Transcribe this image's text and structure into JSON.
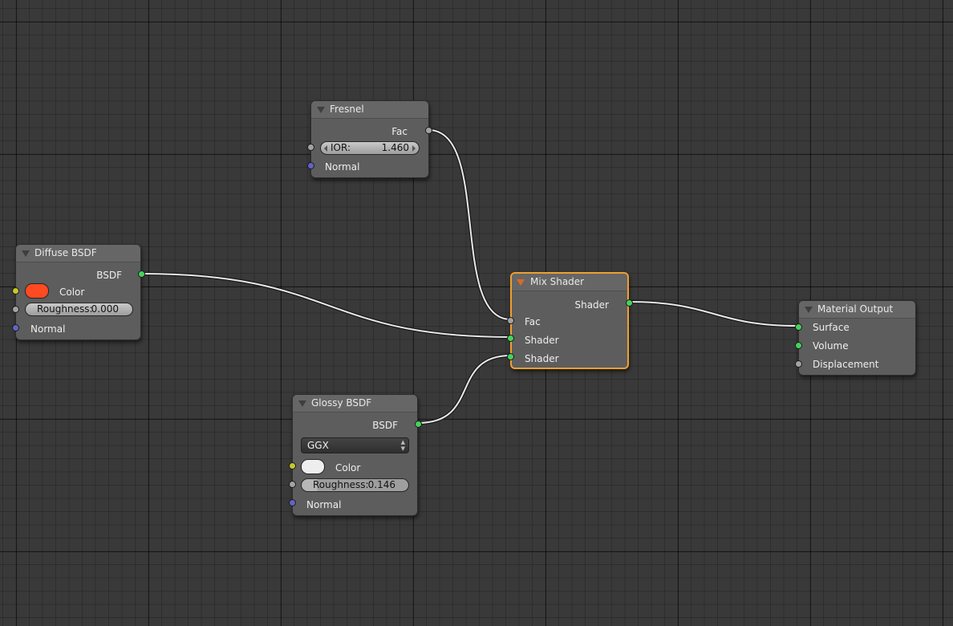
{
  "nodes": {
    "fresnel": {
      "title": "Fresnel",
      "output_fac": "Fac",
      "ior_label": "IOR:",
      "ior_value": "1.460",
      "normal_label": "Normal"
    },
    "diffuse": {
      "title": "Diffuse BSDF",
      "output_bsdf": "BSDF",
      "color_label": "Color",
      "color_value": "#ff4a22",
      "roughness_label": "Roughness:",
      "roughness_value": "0.000",
      "normal_label": "Normal"
    },
    "mix": {
      "title": "Mix Shader",
      "output_shader": "Shader",
      "fac_label": "Fac",
      "shader1_label": "Shader",
      "shader2_label": "Shader"
    },
    "glossy": {
      "title": "Glossy BSDF",
      "output_bsdf": "BSDF",
      "distribution": "GGX",
      "color_label": "Color",
      "color_value": "#eeeeee",
      "roughness_label": "Roughness:",
      "roughness_value": "0.146",
      "normal_label": "Normal"
    },
    "output": {
      "title": "Material Output",
      "surface_label": "Surface",
      "volume_label": "Volume",
      "displacement_label": "Displacement"
    }
  },
  "colors": {
    "selected_outline": "#f0a030",
    "shader_socket": "#44d25c",
    "float_socket": "#a3a3a3",
    "color_socket": "#c7c72a",
    "vector_socket": "#6363c7",
    "link": "#e8e8e8"
  },
  "links": [
    {
      "from": "fresnel.Fac",
      "to": "mix.Fac"
    },
    {
      "from": "diffuse.BSDF",
      "to": "mix.Shader1"
    },
    {
      "from": "glossy.BSDF",
      "to": "mix.Shader2"
    },
    {
      "from": "mix.Shader",
      "to": "output.Surface"
    }
  ]
}
